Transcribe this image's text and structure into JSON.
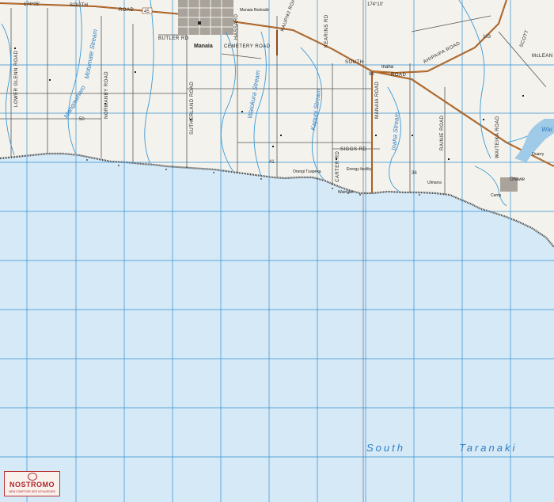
{
  "map": {
    "sea_name_part1": "South",
    "sea_name_part2": "Taranaki",
    "towns": {
      "manaia": "Manaia",
      "inaha": "Inaha",
      "ohawe": "Ohawe",
      "manaia_redoubt": "Manaia Redoubt",
      "orangi_tuapeka": "Orangi Tuapeka",
      "waimate": "Waimate",
      "ulmarra": "Ulmarra",
      "quarry": "Quarry",
      "camp": "Camp",
      "energy_facility": "Energy facility"
    },
    "roads": {
      "south_road_w": "SOUTH",
      "road_w": "ROAD",
      "butler_rd": "BUTLER RD",
      "hassard": "HASSARD",
      "cemetery_road": "CEMETERY ROAD",
      "kenning_rd": "KEARINS RD",
      "lower_glenn_road": "LOWER GLENN ROAD",
      "normanby_road": "NORMANBY ROAD",
      "sutherland_road": "SUTHERLAND ROAD",
      "siggs_rd": "SIGGS RD",
      "south_road_e": "SOUTH",
      "road_e": "ROAD",
      "manaia_road": "MANAIA ROAD",
      "ahipaipa_road": "AHIPAIPA ROAD",
      "scott_road": "SCOTT",
      "mclean_road": "McLEAN",
      "rainie_road": "RAINIE ROAD",
      "waiteika_road": "WAITEIKA ROAD",
      "carter_rd": "CARTER RD",
      "kaupiki_road": "KAUPIKI ROAD",
      "highway_45": "45"
    },
    "streams": {
      "mangawhero": "Mangawhero",
      "waiokura": "Waiokura Stream",
      "kapuni": "Kapuni Stream",
      "inaha": "Inaha Stream",
      "motumate": "Motumate Stream",
      "waingongoro": "Wai"
    },
    "grid_labels": {
      "top_left": "174°05'",
      "top_mid": "174°10'"
    },
    "spot_heights": {
      "h1": "50",
      "h2": "41",
      "h3": "36",
      "h4": "98",
      "h5": "103"
    },
    "colors": {
      "sea": "#d6e9f7",
      "land": "#f4f2ec",
      "grid": "#2f8fd0",
      "road_major": "#8a4a1c",
      "stream": "#3a9ad8",
      "coast": "#333333"
    }
  },
  "logo": {
    "name": "NOSTROMO",
    "tagline": "WEB COMPTOIR DES VOYAGEURS"
  }
}
